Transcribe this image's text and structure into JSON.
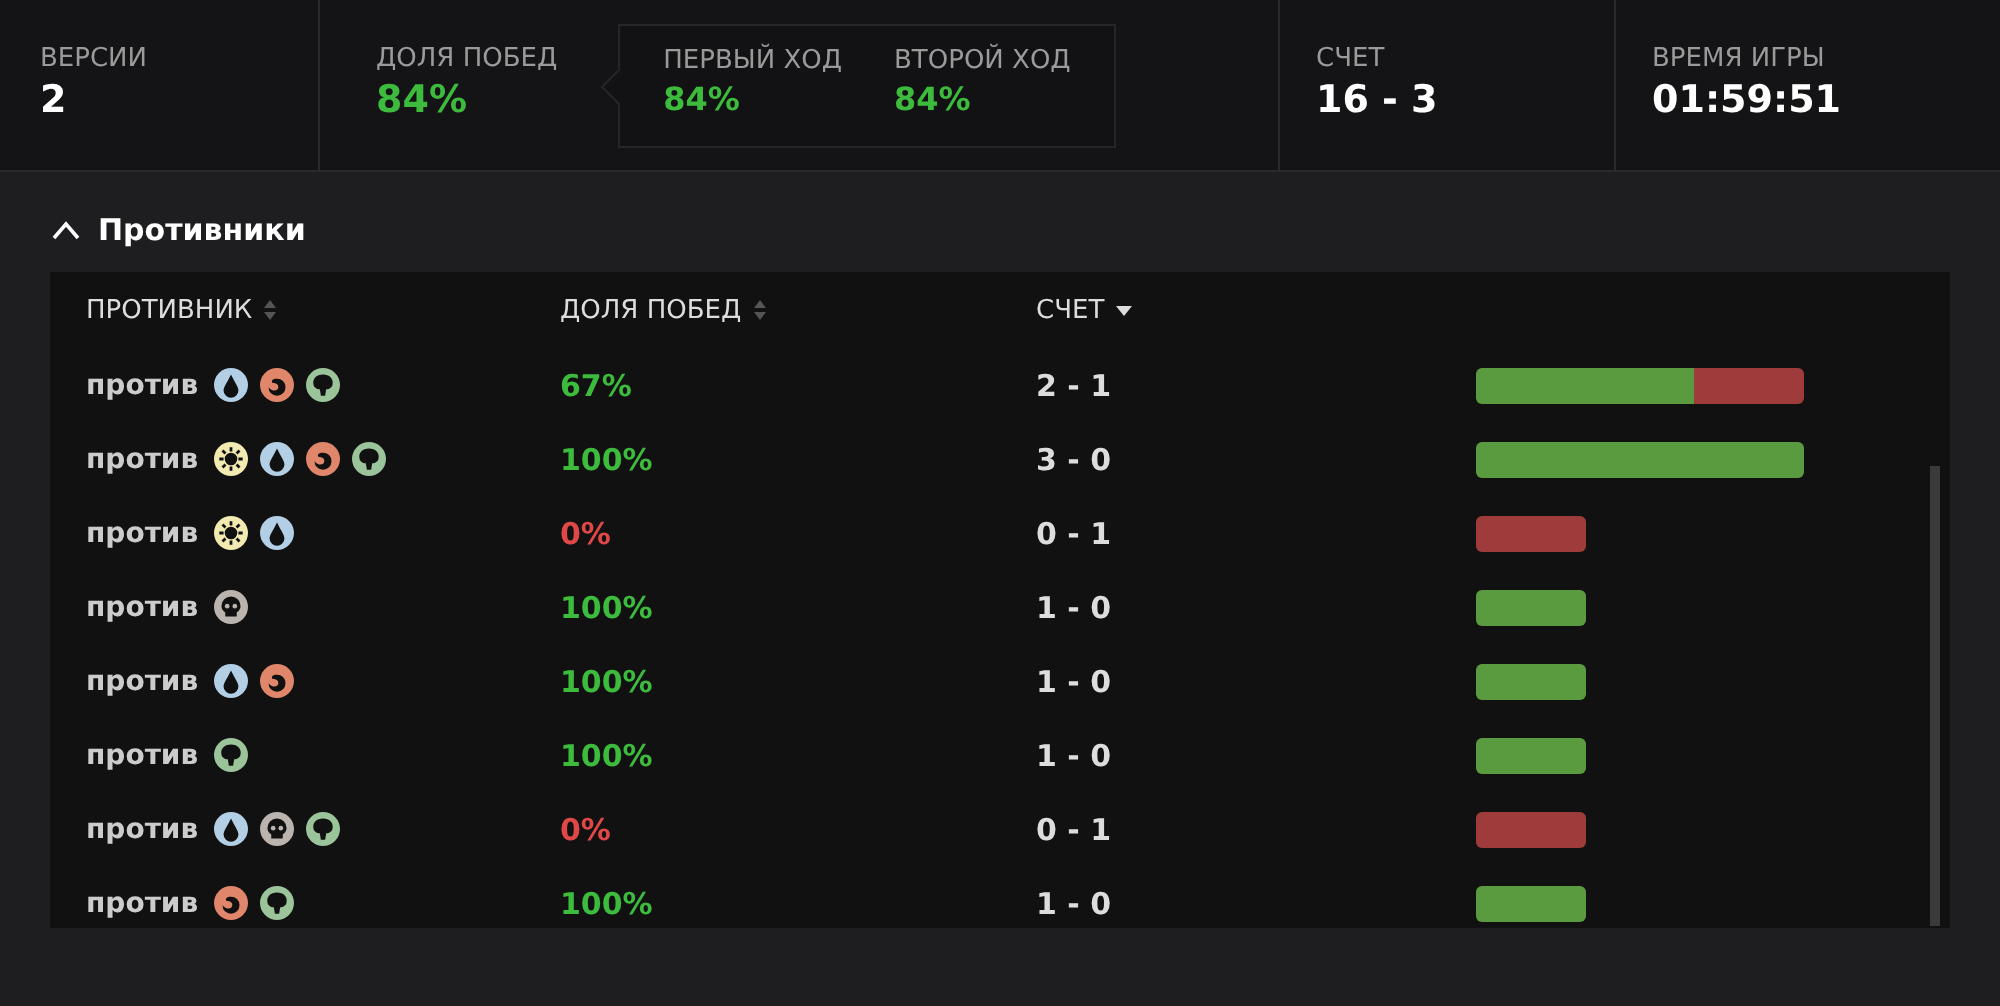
{
  "stats": [
    {
      "label": "ВЕРСИИ",
      "value": "2",
      "kind": "plain"
    },
    {
      "label": "ДОЛЯ ПОБЕД",
      "value": "84%",
      "kind": "rate",
      "details": [
        {
          "label": "ПЕРВЫЙ ХОД",
          "value": "84%"
        },
        {
          "label": "ВТОРОЙ ХОД",
          "value": "84%"
        }
      ]
    },
    {
      "label": "СЧЕТ",
      "value": "16 - 3",
      "kind": "plain"
    },
    {
      "label": "ВРЕМЯ ИГРЫ",
      "value": "01:59:51",
      "kind": "plain"
    }
  ],
  "section": {
    "title": "Противники",
    "expanded": true
  },
  "table": {
    "columns": [
      {
        "label": "ПРОТИВНИК",
        "sorted": false
      },
      {
        "label": "ДОЛЯ ПОБЕД",
        "sorted": false
      },
      {
        "label": "СЧЕТ",
        "sorted": true
      }
    ],
    "rows": [
      {
        "name": "против",
        "symbols": [
          {
            "kind": "drop"
          },
          {
            "kind": "flame"
          },
          {
            "kind": "tree"
          }
        ],
        "rate": "67%",
        "winning": true,
        "score": "2 - 1",
        "games": [
          {
            "kind": "win"
          },
          {
            "kind": "win"
          },
          {
            "kind": "loss"
          }
        ]
      },
      {
        "name": "против",
        "symbols": [
          {
            "kind": "sun"
          },
          {
            "kind": "drop"
          },
          {
            "kind": "flame"
          },
          {
            "kind": "tree"
          }
        ],
        "rate": "100%",
        "winning": true,
        "score": "3 - 0",
        "games": [
          {
            "kind": "win"
          },
          {
            "kind": "win"
          },
          {
            "kind": "win"
          }
        ]
      },
      {
        "name": "против",
        "symbols": [
          {
            "kind": "sun"
          },
          {
            "kind": "drop"
          }
        ],
        "rate": "0%",
        "winning": false,
        "score": "0 - 1",
        "games": [
          {
            "kind": "loss"
          }
        ]
      },
      {
        "name": "против",
        "symbols": [
          {
            "kind": "skull"
          }
        ],
        "rate": "100%",
        "winning": true,
        "score": "1 - 0",
        "games": [
          {
            "kind": "win"
          }
        ]
      },
      {
        "name": "против",
        "symbols": [
          {
            "kind": "drop"
          },
          {
            "kind": "flame"
          }
        ],
        "rate": "100%",
        "winning": true,
        "score": "1 - 0",
        "games": [
          {
            "kind": "win"
          }
        ]
      },
      {
        "name": "против",
        "symbols": [
          {
            "kind": "tree"
          }
        ],
        "rate": "100%",
        "winning": true,
        "score": "1 - 0",
        "games": [
          {
            "kind": "win"
          }
        ]
      },
      {
        "name": "против",
        "symbols": [
          {
            "kind": "drop"
          },
          {
            "kind": "skull"
          },
          {
            "kind": "tree"
          }
        ],
        "rate": "0%",
        "winning": false,
        "score": "0 - 1",
        "games": [
          {
            "kind": "loss"
          }
        ]
      },
      {
        "name": "против",
        "symbols": [
          {
            "kind": "flame"
          },
          {
            "kind": "tree"
          }
        ],
        "rate": "100%",
        "winning": true,
        "score": "1 - 0",
        "games": [
          {
            "kind": "win"
          }
        ]
      }
    ]
  }
}
